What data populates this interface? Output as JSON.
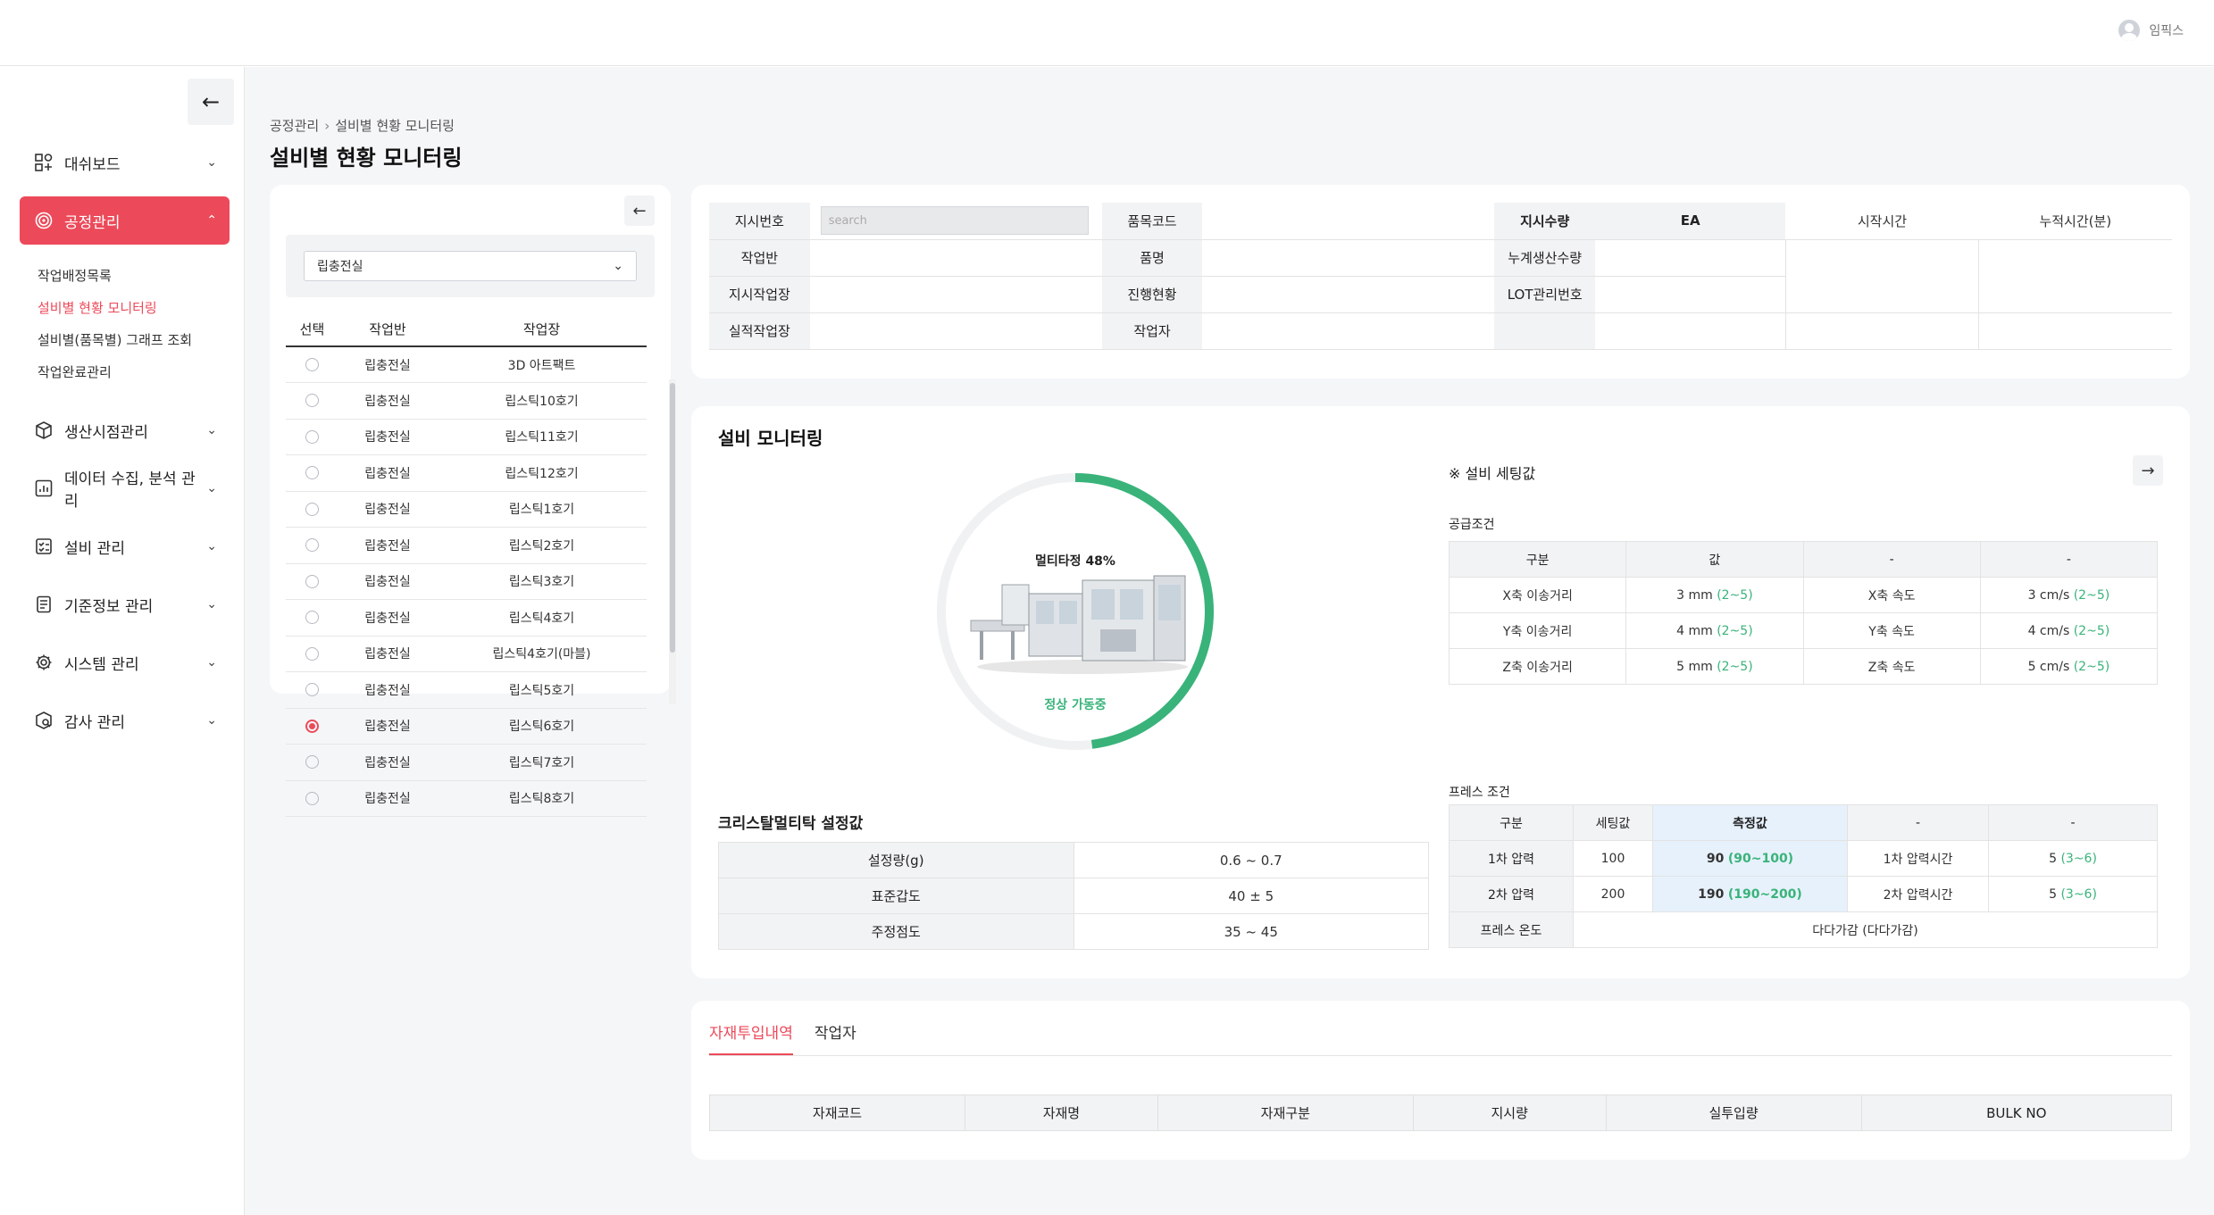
{
  "header": {
    "user_name": "임픽스"
  },
  "sidebar": {
    "collapse_icon": "arrow-left-icon",
    "menu": [
      {
        "label": "대쉬보드",
        "icon": "dashboard-icon"
      },
      {
        "label": "공정관리",
        "icon": "target-icon",
        "active": true,
        "sub": [
          "작업배정목록",
          "설비별 현황 모니터링",
          "설비별(품목별) 그래프 조회",
          "작업완료관리"
        ]
      },
      {
        "label": "생산시점관리",
        "icon": "box-icon"
      },
      {
        "label": "데이터 수집, 분석 관리",
        "icon": "chart-icon"
      },
      {
        "label": "설비 관리",
        "icon": "checklist-icon"
      },
      {
        "label": "기준정보 관리",
        "icon": "document-icon"
      },
      {
        "label": "시스템 관리",
        "icon": "gear-icon"
      },
      {
        "label": "감사 관리",
        "icon": "audit-icon"
      }
    ]
  },
  "breadcrumb": {
    "root": "공정관리",
    "current": "설비별 현황 모니터링"
  },
  "page_title": "설비별 현황 모니터링",
  "left_panel": {
    "select_value": "립충전실",
    "headers": [
      "선택",
      "작업반",
      "작업장"
    ],
    "rows": [
      {
        "team": "립충전실",
        "place": "3D 아트팩트",
        "selected": false
      },
      {
        "team": "립충전실",
        "place": "립스틱10호기",
        "selected": false
      },
      {
        "team": "립충전실",
        "place": "립스틱11호기",
        "selected": false
      },
      {
        "team": "립충전실",
        "place": "립스틱12호기",
        "selected": false
      },
      {
        "team": "립충전실",
        "place": "립스틱1호기",
        "selected": false
      },
      {
        "team": "립충전실",
        "place": "립스틱2호기",
        "selected": false
      },
      {
        "team": "립충전실",
        "place": "립스틱3호기",
        "selected": false
      },
      {
        "team": "립충전실",
        "place": "립스틱4호기",
        "selected": false
      },
      {
        "team": "립충전실",
        "place": "립스틱4호기(마블)",
        "selected": false
      },
      {
        "team": "립충전실",
        "place": "립스틱5호기",
        "selected": false
      },
      {
        "team": "립충전실",
        "place": "립스틱6호기",
        "selected": true
      },
      {
        "team": "립충전실",
        "place": "립스틱7호기",
        "selected": false
      },
      {
        "team": "립충전실",
        "place": "립스틱8호기",
        "selected": false
      }
    ]
  },
  "info": {
    "order_no_label": "지시번호",
    "search_placeholder": "search",
    "item_code_label": "품목코드",
    "qty_label": "지시수량",
    "unit": "EA",
    "start_label": "시작시간",
    "cum_label": "누적시간(분)",
    "team_label": "작업반",
    "item_name_label": "품명",
    "cum_prod_label": "누계생산수량",
    "order_place_label": "지시작업장",
    "progress_label": "진행현황",
    "lot_label": "LOT관리번호",
    "actual_place_label": "실적작업장",
    "worker_label": "작업자"
  },
  "monitor": {
    "title": "설비 모니터링",
    "gauge_label": "멀티타정 48%",
    "gauge_percent": 48,
    "status": "정상 가동중",
    "crystal_title": "크리스탈멀티탁 설정값",
    "crystal_rows": [
      {
        "label": "설정량(g)",
        "value": "0.6 ~ 0.7"
      },
      {
        "label": "표준갑도",
        "value": "40 ± 5"
      },
      {
        "label": "주정점도",
        "value": "35 ~ 45"
      }
    ],
    "setting_title": "※ 설비 세팅값",
    "supply_label": "공급조건",
    "supply_headers": [
      "구분",
      "값",
      "-",
      "-"
    ],
    "supply_rows": [
      {
        "a": "X축 이송거리",
        "v": "3 mm",
        "r": "(2~5)",
        "b": "X축 속도",
        "v2": "3 cm/s",
        "r2": "(2~5)"
      },
      {
        "a": "Y축 이송거리",
        "v": "4 mm",
        "r": "(2~5)",
        "b": "Y축 속도",
        "v2": "4 cm/s",
        "r2": "(2~5)"
      },
      {
        "a": "Z축 이송거리",
        "v": "5 mm",
        "r": "(2~5)",
        "b": "Z축 속도",
        "v2": "5 cm/s",
        "r2": "(2~5)"
      }
    ],
    "press_label": "프레스 조건",
    "press_headers": [
      "구분",
      "세팅값",
      "측정값",
      "-",
      "-"
    ],
    "press_rows": [
      {
        "a": "1차 압력",
        "set": "100",
        "meas": "90",
        "mr": "(90~100)",
        "b": "1차 압력시간",
        "v": "5",
        "vr": "(3~6)"
      },
      {
        "a": "2차 압력",
        "set": "200",
        "meas": "190",
        "mr": "(190~200)",
        "b": "2차 압력시간",
        "v": "5",
        "vr": "(3~6)"
      }
    ],
    "press_temp_label": "프레스 온도",
    "press_temp_value": "다다가감 (다다가감)"
  },
  "bottom": {
    "tabs": [
      "자재투입내역",
      "작업자"
    ],
    "headers": [
      "자재코드",
      "자재명",
      "자재구분",
      "지시량",
      "실투입량",
      "BULK NO"
    ]
  },
  "colors": {
    "accent": "#ec4a5a",
    "green": "#39b37a"
  }
}
